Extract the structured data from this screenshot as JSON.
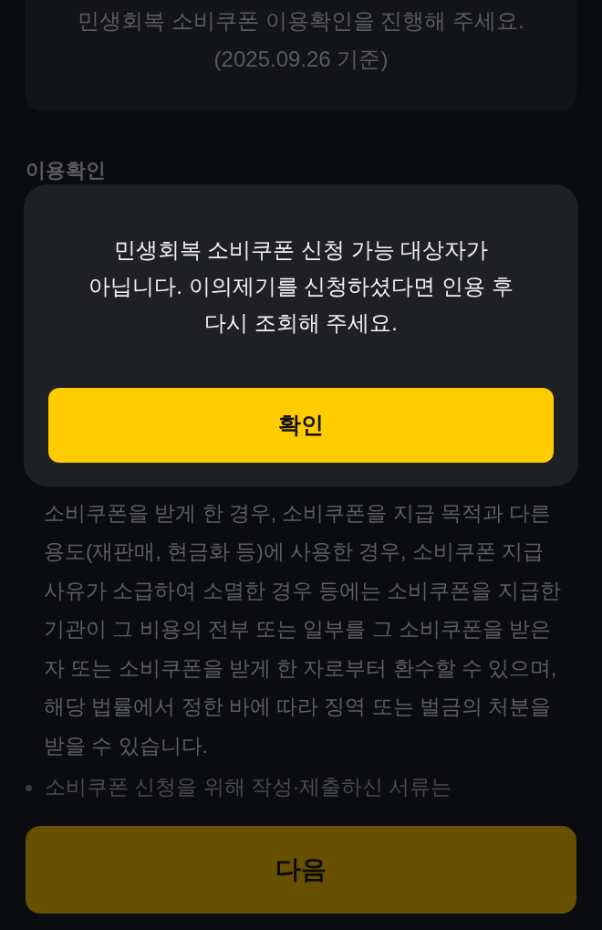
{
  "info_card": {
    "lines": [
      "민생회복 소비쿠폰 이용확인을 진행해 주세요.",
      "(2025.09.26 기준)"
    ]
  },
  "section_title": "이용확인",
  "dialog": {
    "message": "민생회복 소비쿠폰 신청 가능 대상자가 아닙니다. 이의제기를 신청하셨다면 인용 후 다시 조회해 주세요.",
    "confirm_button": "확인"
  },
  "notice": {
    "paragraph": "소비쿠폰을 받게 한 경우, 소비쿠폰을 지급 목적과 다른 용도(재판매, 현금화 등)에 사용한 경우, 소비쿠폰 지급 사유가 소급하여 소멸한 경우 등에는 소비쿠폰을 지급한 기관이 그 비용의 전부 또는 일부를 그 소비쿠폰을 받은 자 또는 소비쿠폰을 받게 한 자로부터 환수할 수 있으며, 해당 법률에서 정한 바에 따라 징역 또는 벌금의 처분을 받을 수 있습니다.",
    "bullets": [
      "소비쿠폰 신청을 위해 작성·제출하신 서류는"
    ]
  },
  "next_button": "다음"
}
